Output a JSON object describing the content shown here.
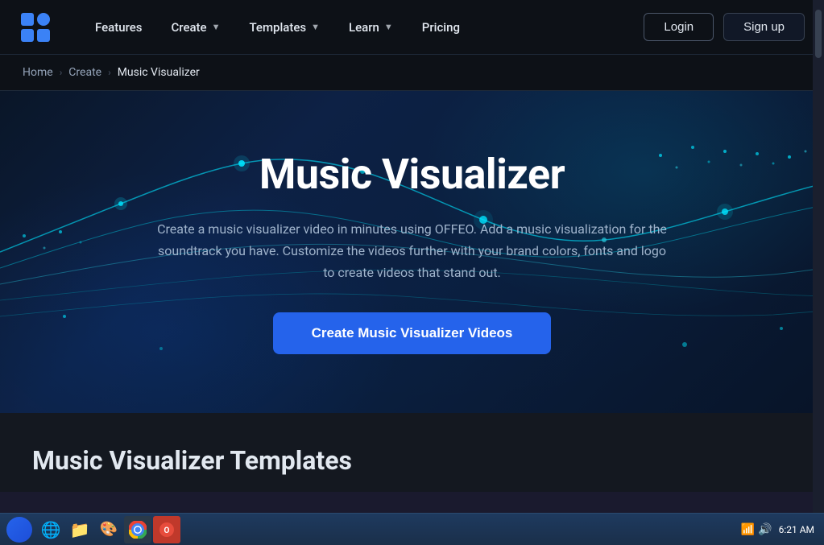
{
  "brand": {
    "name": "OFFEO",
    "logo_alt": "OFFEO logo"
  },
  "navbar": {
    "features_label": "Features",
    "create_label": "Create",
    "templates_label": "Templates",
    "learn_label": "Learn",
    "pricing_label": "Pricing",
    "login_label": "Login",
    "signup_label": "Sign up"
  },
  "breadcrumb": {
    "home_label": "Home",
    "create_label": "Create",
    "current_label": "Music Visualizer",
    "sep": "›"
  },
  "hero": {
    "title": "Music Visualizer",
    "description": "Create a music visualizer video in minutes using OFFEO. Add a music visualization for the soundtrack you have. Customize the videos further with your brand colors, fonts and logo to create videos that stand out.",
    "cta_label": "Create Music Visualizer Videos"
  },
  "bottom": {
    "section_title": "Music Visualizer Templates"
  },
  "taskbar": {
    "time": "6:21 AM",
    "icons": [
      "🟦",
      "🌐",
      "📁",
      "🎨",
      "🟠",
      "🔵",
      "🔴"
    ]
  }
}
